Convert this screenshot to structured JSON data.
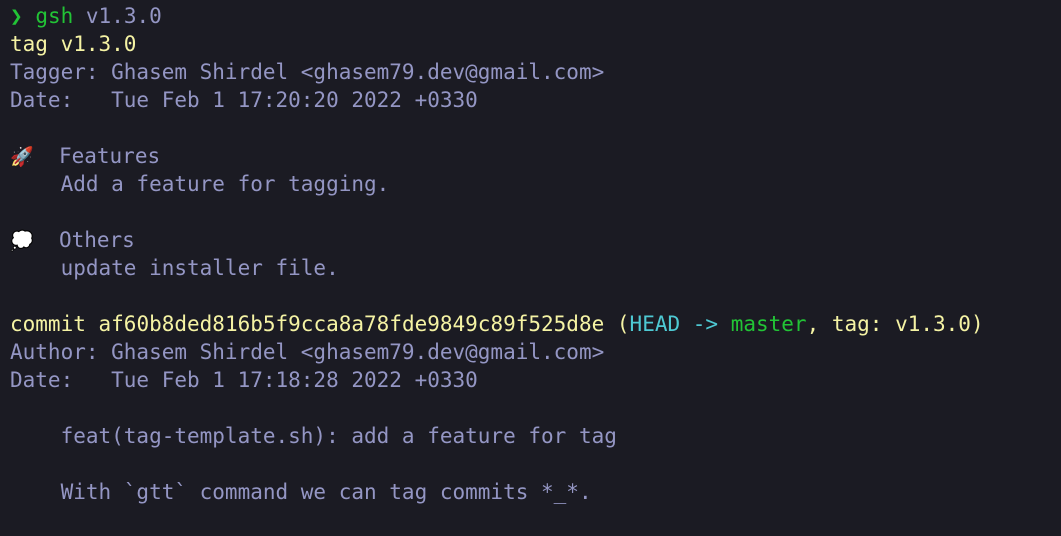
{
  "terminal": {
    "background_color": "#1b1b23",
    "default_text_color": "#9496c4",
    "accent_green": "#22c436",
    "accent_yellow": "#f5f3a4",
    "accent_cyan": "#4ec9d3",
    "accent_white": "#d7d8ea",
    "font_size_px": 21,
    "line_height_px": 28
  },
  "prompt": {
    "symbol": "❯",
    "command": "gsh",
    "argument": "v1.3.0"
  },
  "tag_block": {
    "tag_line": "tag v1.3.0",
    "tagger_line": "Tagger: Ghasem Shirdel <ghasem79.dev@gmail.com>",
    "date_line": "Date:   Tue Feb 1 17:20:20 2022 +0330",
    "sections": [
      {
        "icon": "🚀",
        "icon_name": "rocket-icon",
        "heading": "Features",
        "items": [
          "    Add a feature for tagging."
        ]
      },
      {
        "icon": "💭",
        "icon_name": "thought-balloon-icon",
        "heading": "Others",
        "items": [
          "    update installer file."
        ]
      }
    ]
  },
  "commit_block": {
    "commit_keyword": "commit",
    "commit_hash": "af60b8ded816b5f9cca8a78fde9849c89f525d8e",
    "decoration_open": " (",
    "head_ref": "HEAD",
    "arrow": " -> ",
    "branch": "master",
    "separator": ", ",
    "tag_label": "tag: v1.3.0",
    "decoration_close": ")",
    "author_line": "Author: Ghasem Shirdel <ghasem79.dev@gmail.com>",
    "date_line": "Date:   Tue Feb 1 17:18:28 2022 +0330",
    "message_subject": "    feat(tag-template.sh): add a feature for tag",
    "message_body": "    With `gtt` command we can tag commits *_*."
  }
}
